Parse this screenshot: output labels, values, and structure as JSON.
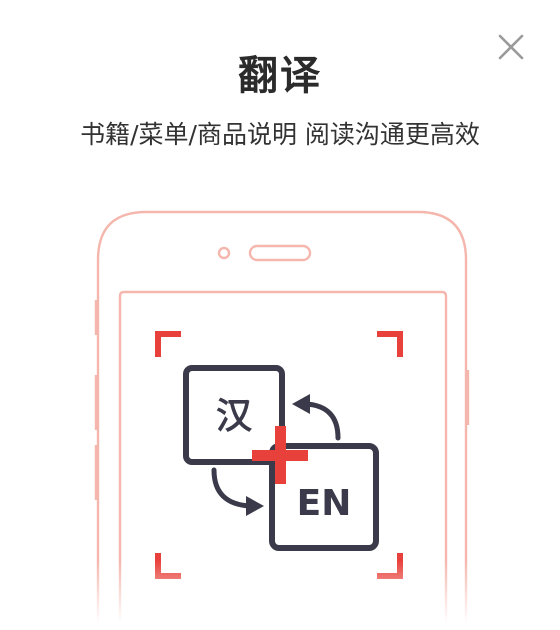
{
  "dialog": {
    "title": "翻译",
    "subtitle": "书籍/菜单/商品说明 阅读沟通更高效",
    "close_icon": "close-icon"
  },
  "illustration": {
    "source_lang_label": "汉",
    "target_lang_label": "EN",
    "icons": [
      "phone-outline-icon",
      "scan-frame-icon",
      "translate-arrows-icon"
    ]
  },
  "colors": {
    "phone_outline": "#f4b6ad",
    "scan_corner": "#e8413b",
    "card_stroke": "#3a3a4a",
    "title_text": "#2b2b2b",
    "close_icon": "#9a9a9a"
  }
}
